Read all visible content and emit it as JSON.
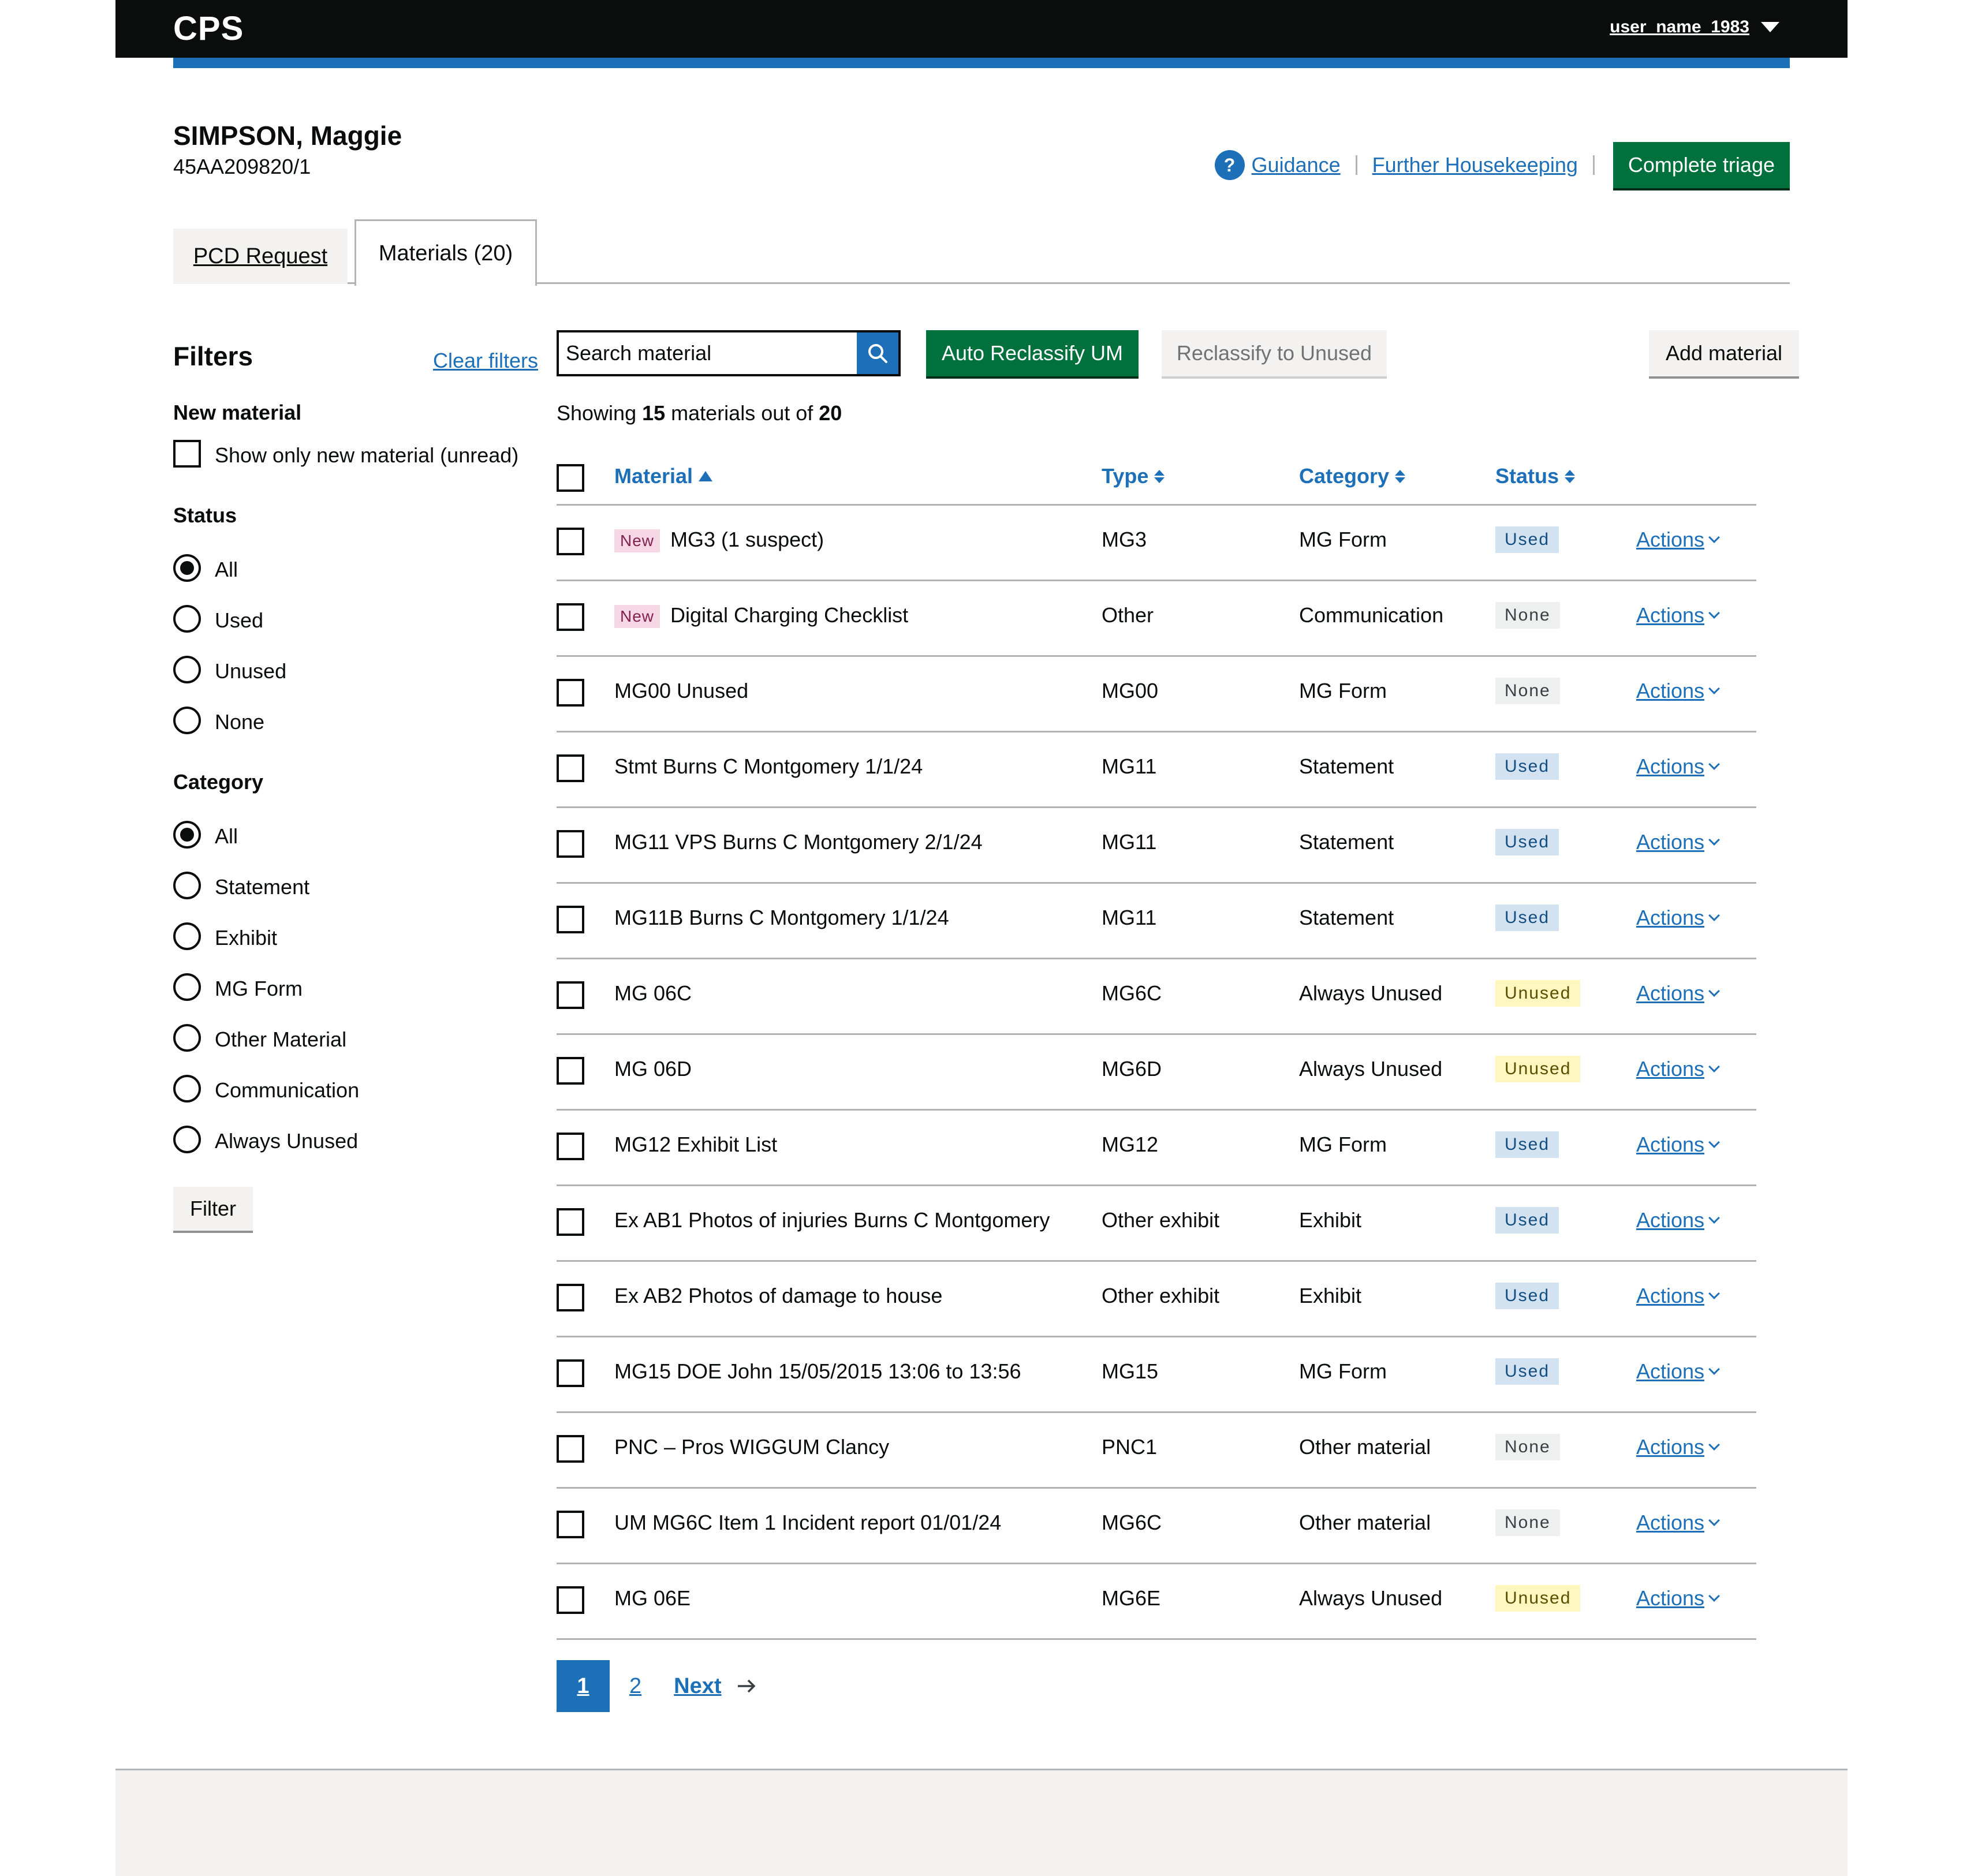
{
  "header": {
    "logo": "CPS",
    "user": "user_name_1983"
  },
  "case": {
    "name": "SIMPSON, Maggie",
    "id": "45AA209820/1"
  },
  "top_actions": {
    "guidance": "Guidance",
    "housekeeping": "Further Housekeeping",
    "complete": "Complete triage"
  },
  "tabs": {
    "pcd": "PCD Request",
    "materials": "Materials (20)"
  },
  "filters": {
    "title": "Filters",
    "clear": "Clear filters",
    "new_material": {
      "heading": "New material",
      "checkbox": "Show only new material (unread)"
    },
    "status": {
      "heading": "Status",
      "options": [
        "All",
        "Used",
        "Unused",
        "None"
      ],
      "selected": "All"
    },
    "category": {
      "heading": "Category",
      "options": [
        "All",
        "Statement",
        "Exhibit",
        "MG Form",
        "Other Material",
        "Communication",
        "Always Unused"
      ],
      "selected": "All"
    },
    "button": "Filter"
  },
  "toolbar": {
    "search_value": "Search material",
    "auto_reclassify": "Auto Reclassify UM",
    "reclassify_unused": "Reclassify to Unused",
    "add_material": "Add material"
  },
  "summary": {
    "prefix": "Showing ",
    "shown": "15",
    "middle": " materials out of ",
    "total": "20"
  },
  "table": {
    "headers": {
      "material": "Material",
      "type": "Type",
      "category": "Category",
      "status": "Status"
    },
    "actions_label": "Actions",
    "new_label": "New",
    "rows": [
      {
        "new": true,
        "material": "MG3 (1 suspect)",
        "type": "MG3",
        "category": "MG Form",
        "status": "Used"
      },
      {
        "new": true,
        "material": "Digital Charging Checklist",
        "type": "Other",
        "category": "Communication",
        "status": "None"
      },
      {
        "new": false,
        "material": "MG00 Unused",
        "type": "MG00",
        "category": "MG Form",
        "status": "None"
      },
      {
        "new": false,
        "material": "Stmt Burns C Montgomery 1/1/24",
        "type": "MG11",
        "category": "Statement",
        "status": "Used"
      },
      {
        "new": false,
        "material": "MG11 VPS  Burns C Montgomery 2/1/24",
        "type": "MG11",
        "category": "Statement",
        "status": "Used"
      },
      {
        "new": false,
        "material": "MG11B  Burns C Montgomery 1/1/24",
        "type": "MG11",
        "category": "Statement",
        "status": "Used"
      },
      {
        "new": false,
        "material": "MG 06C",
        "type": "MG6C",
        "category": "Always Unused",
        "status": "Unused"
      },
      {
        "new": false,
        "material": "MG 06D",
        "type": "MG6D",
        "category": "Always Unused",
        "status": "Unused"
      },
      {
        "new": false,
        "material": "MG12 Exhibit List",
        "type": "MG12",
        "category": "MG Form",
        "status": "Used"
      },
      {
        "new": false,
        "material": "Ex AB1 Photos of injuries Burns C Montgomery",
        "type": "Other exhibit",
        "category": "Exhibit",
        "status": "Used"
      },
      {
        "new": false,
        "material": "Ex AB2 Photos of damage to house",
        "type": "Other exhibit",
        "category": "Exhibit",
        "status": "Used"
      },
      {
        "new": false,
        "material": "MG15 DOE John 15/05/2015 13:06 to 13:56",
        "type": "MG15",
        "category": "MG Form",
        "status": "Used"
      },
      {
        "new": false,
        "material": "PNC – Pros WIGGUM Clancy",
        "type": "PNC1",
        "category": "Other material",
        "status": "None"
      },
      {
        "new": false,
        "material": "UM MG6C Item 1 Incident report 01/01/24",
        "type": "MG6C",
        "category": "Other material",
        "status": "None"
      },
      {
        "new": false,
        "material": "MG 06E",
        "type": "MG6E",
        "category": "Always Unused",
        "status": "Unused"
      }
    ]
  },
  "pagination": {
    "current": "1",
    "pages": [
      "2"
    ],
    "next": "Next"
  }
}
